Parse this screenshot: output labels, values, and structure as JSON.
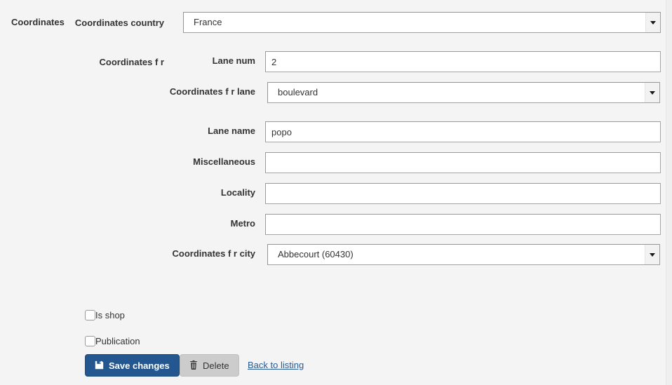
{
  "section": {
    "title": "Coordinates"
  },
  "groups": {
    "country_label": "Coordinates country",
    "fr_label": "Coordinates f r"
  },
  "fields": {
    "country": {
      "label": "Coordinates country",
      "type": "select",
      "value": "France"
    },
    "lane_num": {
      "label": "Lane num",
      "type": "text",
      "value": "2",
      "placeholder": ""
    },
    "lane_type": {
      "label": "Coordinates f r lane",
      "type": "select",
      "value": "boulevard"
    },
    "lane_name": {
      "label": "Lane name",
      "type": "text",
      "value": "popo",
      "placeholder": ""
    },
    "miscellaneous": {
      "label": "Miscellaneous",
      "type": "text",
      "value": "",
      "placeholder": ""
    },
    "locality": {
      "label": "Locality",
      "type": "text",
      "value": "",
      "placeholder": ""
    },
    "metro": {
      "label": "Metro",
      "type": "text",
      "value": "",
      "placeholder": ""
    },
    "city": {
      "label": "Coordinates f r city",
      "type": "select",
      "value": "Abbecourt (60430)"
    }
  },
  "checkboxes": {
    "is_shop": {
      "label": "Is shop",
      "checked": false
    },
    "publication": {
      "label": "Publication",
      "checked": false
    }
  },
  "actions": {
    "save": {
      "label": "Save changes",
      "icon": "save-floppy-icon",
      "glyph": "💾"
    },
    "delete": {
      "label": "Delete",
      "icon": "trash-icon",
      "glyph": "🗑"
    },
    "back": {
      "label": "Back to listing"
    }
  },
  "colors": {
    "page_background": "#f4f4f4",
    "primary_button": "#24568f",
    "default_button": "#cccccc",
    "link": "#2a5b91",
    "text": "#333333",
    "input_border": "#a6a6a6",
    "input_background": "#ffffff"
  },
  "icons": {
    "dropdown": "chevron-down-icon"
  }
}
